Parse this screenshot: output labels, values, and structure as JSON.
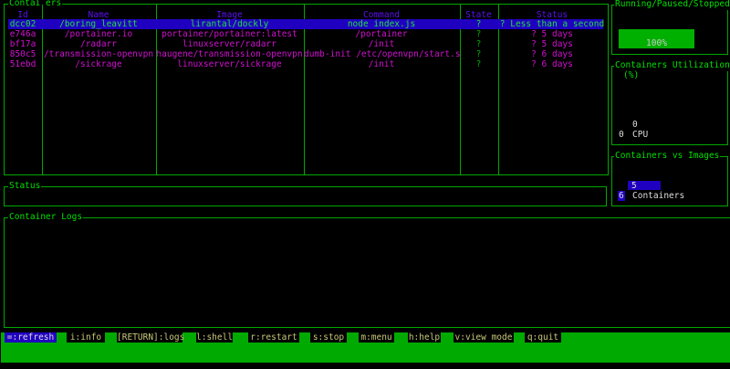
{
  "containers": {
    "title": "Contai ers",
    "headers": [
      "Id",
      "Name",
      "Image",
      "Command",
      "State",
      "Status"
    ],
    "rows": [
      [
        "dcc02",
        "/boring_leavitt",
        "lirantal/dockly",
        "node index.js",
        "?",
        "? Less than a second"
      ],
      [
        "e746a",
        "/portainer.io",
        "portainer/portainer:latest",
        "/portainer",
        "?",
        "? 5 days"
      ],
      [
        "bf17a",
        "/radarr",
        "linuxserver/radarr",
        "/init",
        "?",
        "? 5 days"
      ],
      [
        "850c5",
        "/transmission-openvpn",
        "haugene/transmission-openvpn",
        "dumb-init /etc/openvpn/start.s",
        "?",
        "? 6 days"
      ],
      [
        "51ebd",
        "/sickrage",
        "linuxserver/sickrage",
        "/init",
        "?",
        "? 6 days"
      ]
    ],
    "selected_index": 0
  },
  "status": {
    "title": "Status"
  },
  "logs": {
    "title": "Container Logs"
  },
  "running": {
    "title": "Running/Paused/Stopped",
    "percent_label": "100%",
    "percent": 100
  },
  "utilization": {
    "title": "Containers Utilization",
    "subtitle": "(%)",
    "value": "0",
    "axis": "0",
    "label": "CPU"
  },
  "vs_images": {
    "title": "Containers vs Images",
    "bar_value": "5",
    "count": "6",
    "label": "Containers"
  },
  "shortcuts": [
    "=:refresh",
    "i:info",
    "[RETURN]:logs",
    "l:shell",
    "r:restart",
    "s:stop",
    "m:menu",
    "h:help",
    "v:view mode",
    "q:quit"
  ],
  "colors": {
    "border": "#00a800",
    "selected": "#2000c0",
    "accent": "#d010d0"
  }
}
